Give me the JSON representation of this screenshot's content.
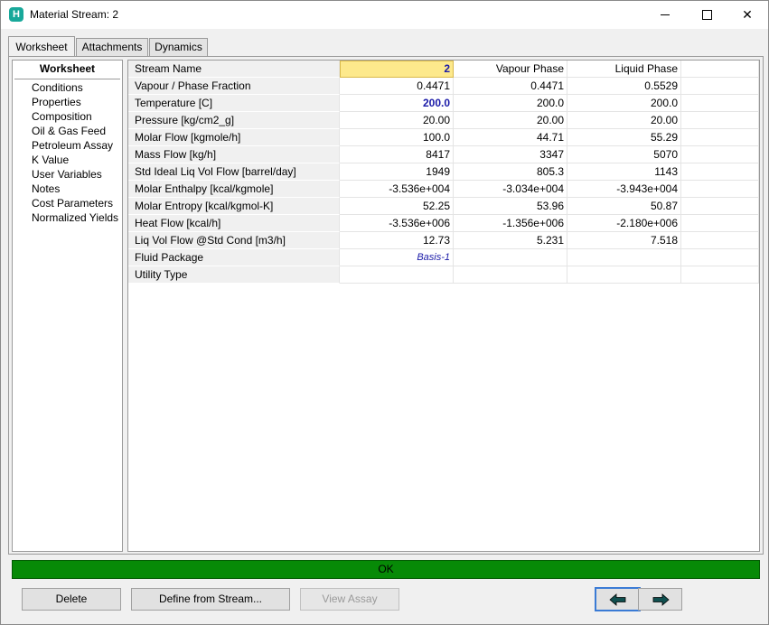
{
  "window": {
    "title": "Material Stream: 2"
  },
  "tabs": [
    "Worksheet",
    "Attachments",
    "Dynamics"
  ],
  "nav": {
    "header": "Worksheet",
    "items": [
      "Conditions",
      "Properties",
      "Composition",
      "Oil & Gas Feed",
      "Petroleum Assay",
      "K Value",
      "User Variables",
      "Notes",
      "Cost Parameters",
      "Normalized Yields"
    ]
  },
  "grid": {
    "rows": [
      {
        "label": "Stream Name",
        "v1": "2",
        "v2": "Vapour Phase",
        "v3": "Liquid Phase"
      },
      {
        "label": "Vapour / Phase Fraction",
        "v1": "0.4471",
        "v2": "0.4471",
        "v3": "0.5529"
      },
      {
        "label": "Temperature [C]",
        "v1": "200.0",
        "v2": "200.0",
        "v3": "200.0"
      },
      {
        "label": "Pressure [kg/cm2_g]",
        "v1": "20.00",
        "v2": "20.00",
        "v3": "20.00"
      },
      {
        "label": "Molar Flow [kgmole/h]",
        "v1": "100.0",
        "v2": "44.71",
        "v3": "55.29"
      },
      {
        "label": "Mass Flow [kg/h]",
        "v1": "8417",
        "v2": "3347",
        "v3": "5070"
      },
      {
        "label": "Std Ideal Liq Vol Flow [barrel/day]",
        "v1": "1949",
        "v2": "805.3",
        "v3": "1143"
      },
      {
        "label": "Molar Enthalpy [kcal/kgmole]",
        "v1": "-3.536e+004",
        "v2": "-3.034e+004",
        "v3": "-3.943e+004"
      },
      {
        "label": "Molar Entropy [kcal/kgmol-K]",
        "v1": "52.25",
        "v2": "53.96",
        "v3": "50.87"
      },
      {
        "label": "Heat Flow [kcal/h]",
        "v1": "-3.536e+006",
        "v2": "-1.356e+006",
        "v3": "-2.180e+006"
      },
      {
        "label": "Liq Vol Flow @Std Cond [m3/h]",
        "v1": "12.73",
        "v2": "5.231",
        "v3": "7.518"
      },
      {
        "label": "Fluid Package",
        "v1": "Basis-1",
        "v2": "",
        "v3": ""
      },
      {
        "label": "Utility Type",
        "v1": "",
        "v2": "",
        "v3": ""
      }
    ]
  },
  "status": {
    "text": "OK",
    "color": "#078a07"
  },
  "buttons": {
    "delete": "Delete",
    "define": "Define from Stream...",
    "view_assay": "View Assay"
  },
  "icons": {
    "back": "arrow-left-icon",
    "forward": "arrow-right-icon"
  }
}
